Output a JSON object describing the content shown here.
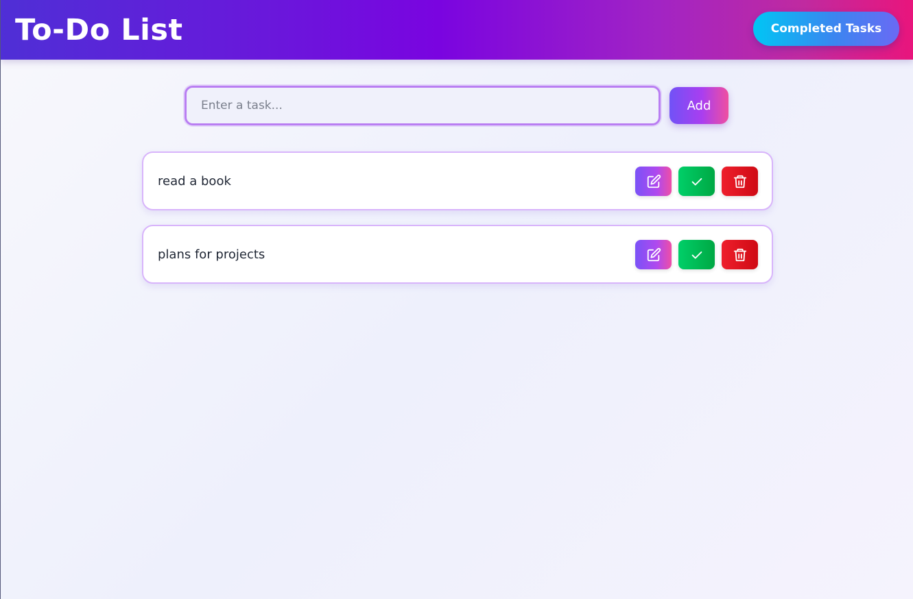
{
  "header": {
    "title": "To-Do List",
    "completed_label": "Completed Tasks"
  },
  "input": {
    "placeholder": "Enter a task...",
    "value": "",
    "add_label": "Add"
  },
  "tasks": [
    {
      "text": "read a book",
      "icons": [
        "edit-icon",
        "check-icon",
        "trash-icon"
      ]
    },
    {
      "text": "plans for projects",
      "icons": [
        "edit-icon",
        "check-icon",
        "trash-icon"
      ]
    }
  ],
  "colors": {
    "header_gradient": [
      "#4f2fd6",
      "#7a04e0",
      "#e9157c"
    ],
    "edit": "#9b4ff2",
    "complete": "#00b84f",
    "delete": "#e0141f"
  }
}
